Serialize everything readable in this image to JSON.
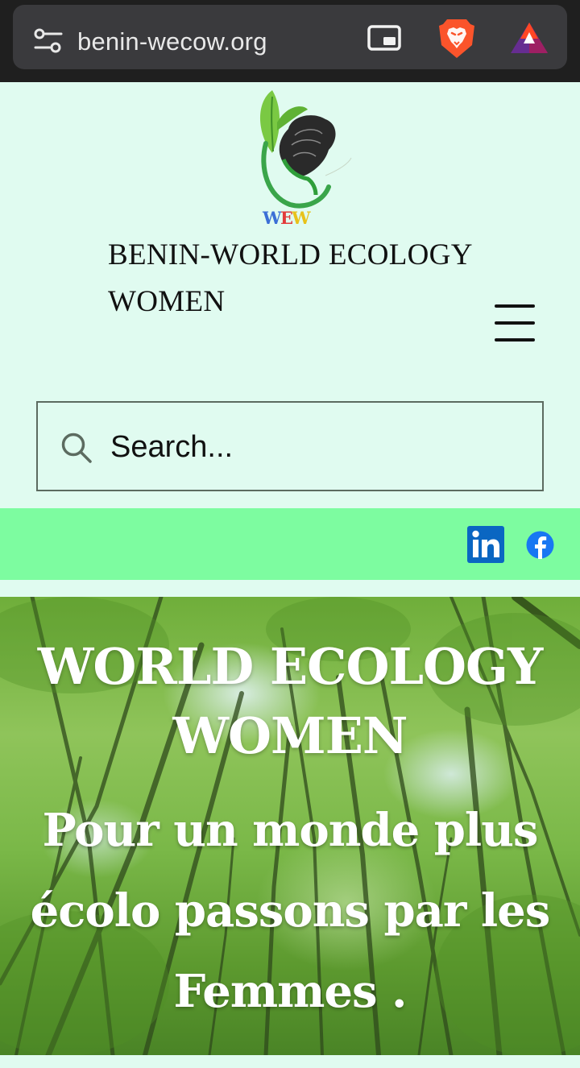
{
  "browser": {
    "url": "benin-wecow.org",
    "icons": [
      "tune-icon",
      "picture-in-picture-icon",
      "brave-lion-icon",
      "brave-rewards-triangle-icon"
    ]
  },
  "header": {
    "logo_text": "WEW",
    "site_title": "BENIN-WORLD ECOLOGY WOMEN",
    "menu_icon": "hamburger-menu-icon"
  },
  "search": {
    "placeholder": "Search...",
    "icon": "search-icon"
  },
  "social": {
    "items": [
      {
        "name": "LinkedIn",
        "icon": "linkedin-icon",
        "color": "#0a66c2"
      },
      {
        "name": "Facebook",
        "icon": "facebook-icon",
        "color": "#1877f2"
      }
    ],
    "bar_color": "#7dfca0"
  },
  "hero": {
    "title": "WORLD ECOLOGY WOMEN",
    "subtitle": "Pour un monde plus écolo passons par les Femmes ."
  },
  "colors": {
    "page_background": "#e0fbf0",
    "browser_bar": "#1f1f1f",
    "url_pill": "#3a3a3d"
  }
}
